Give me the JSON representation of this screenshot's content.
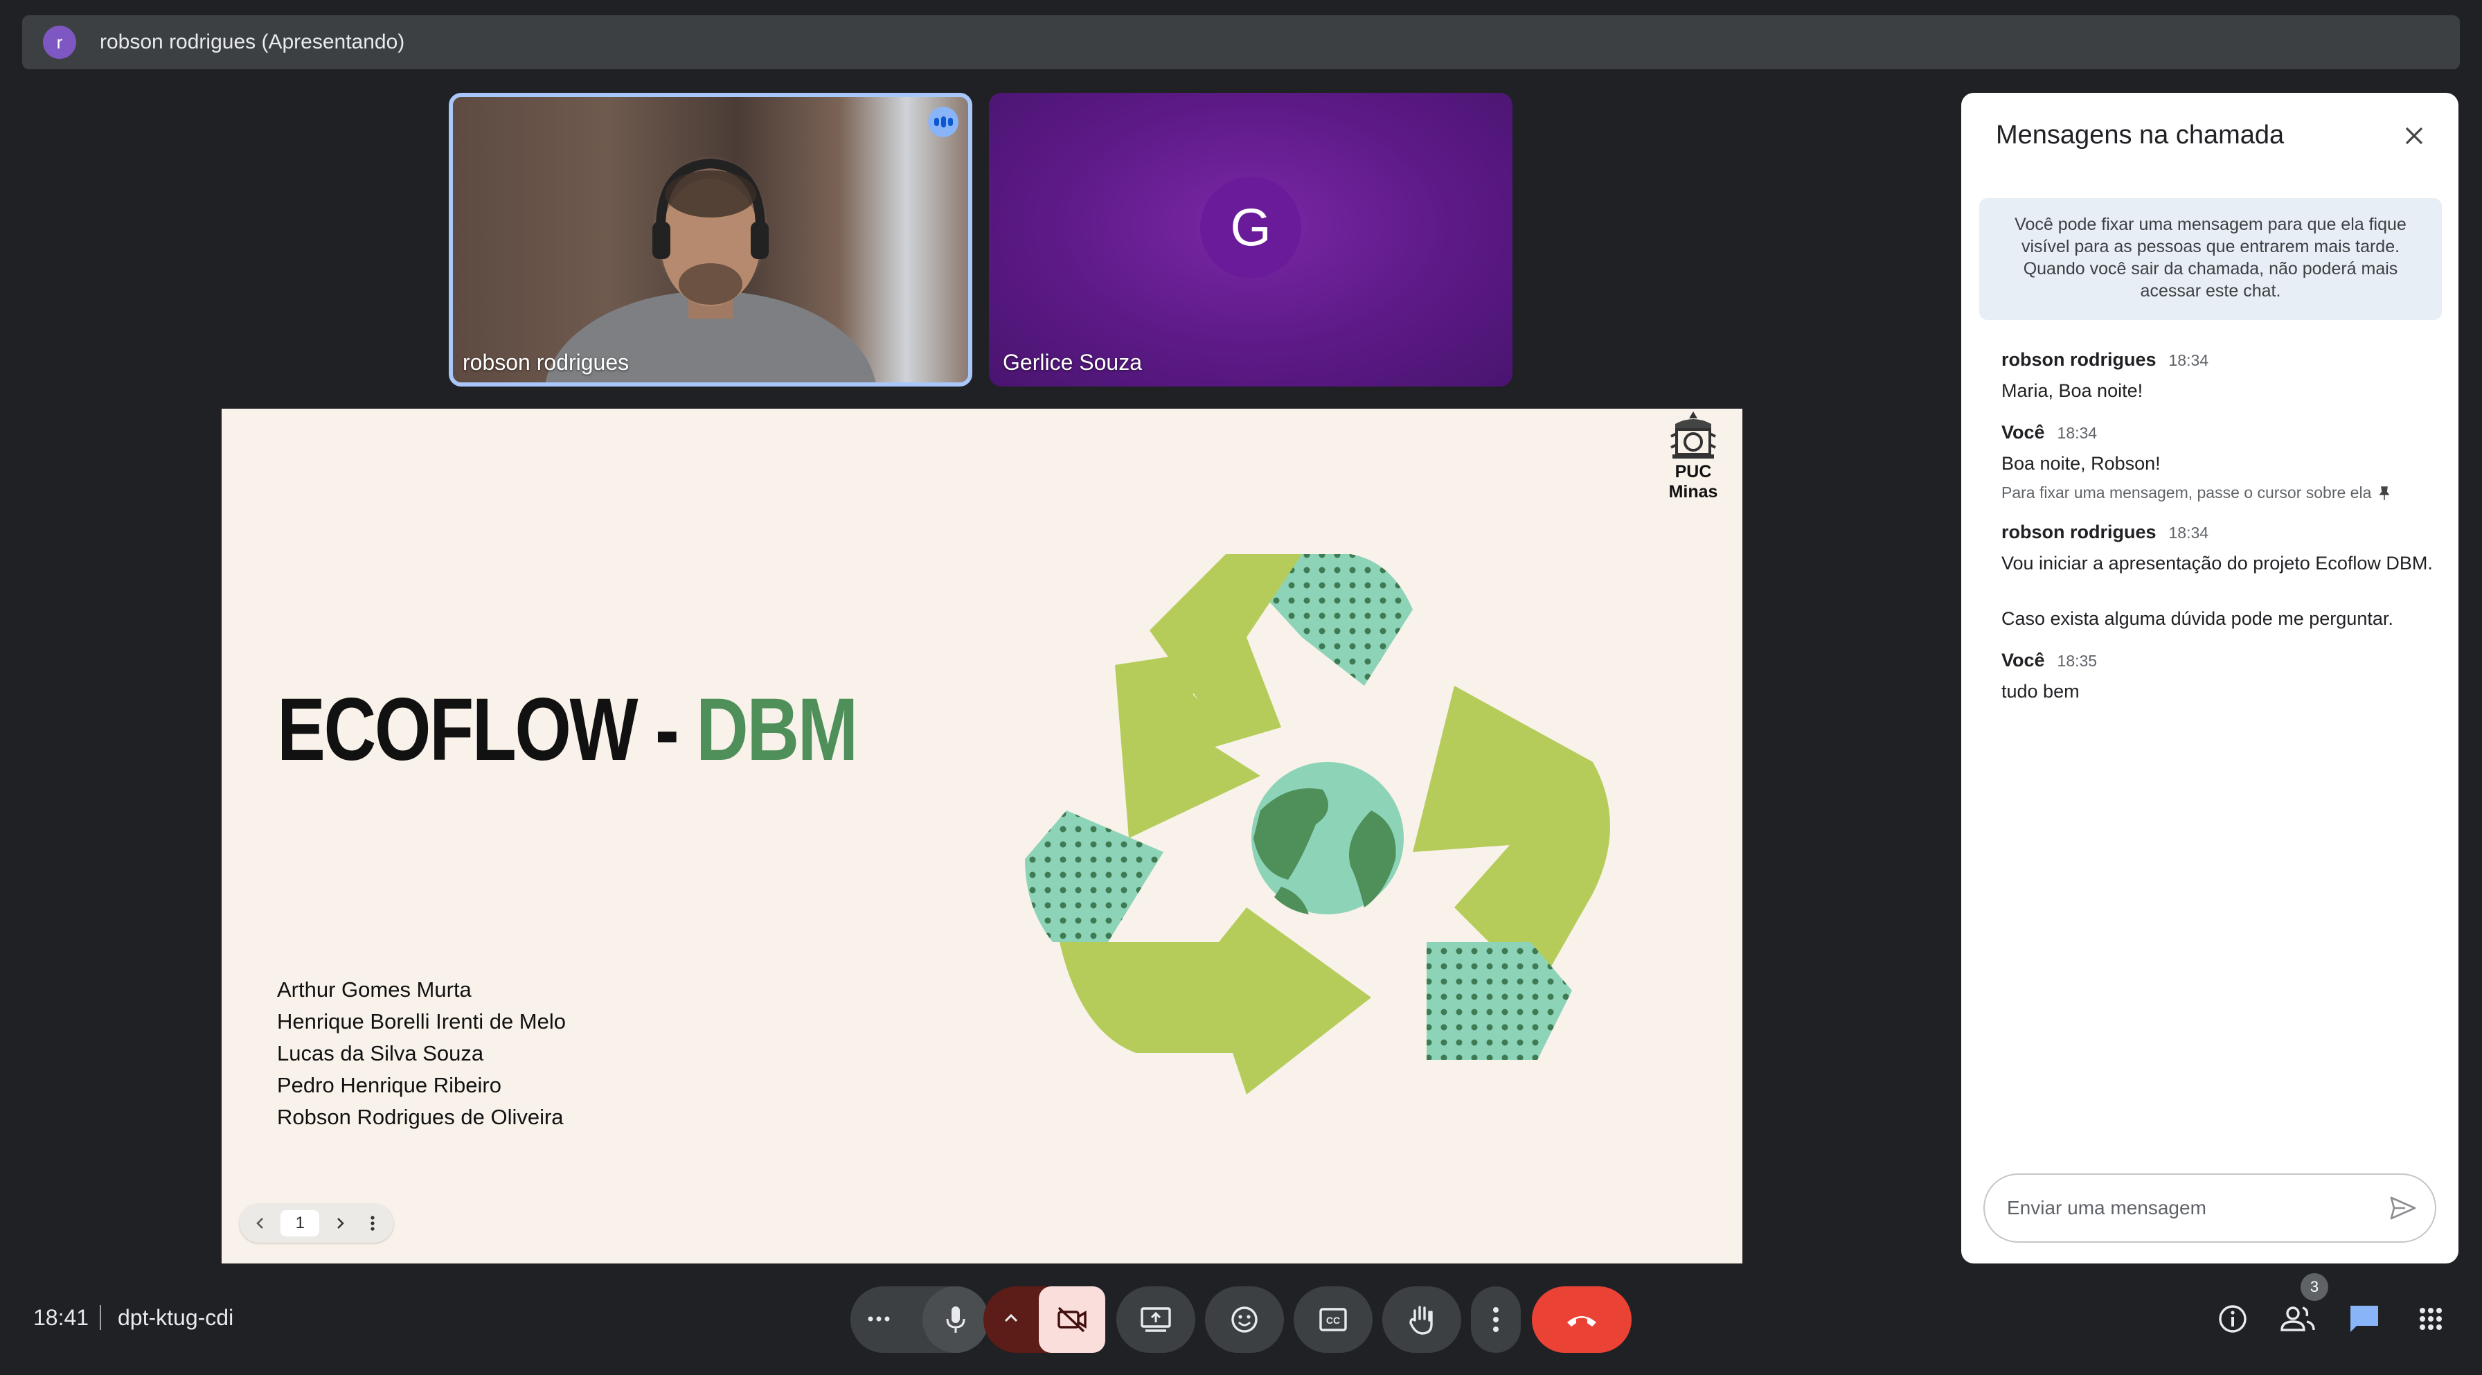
{
  "presenter_bar": {
    "avatar_letter": "r",
    "label": "robson rodrigues (Apresentando)"
  },
  "participants": [
    {
      "name": "robson rodrigues",
      "speaking": true
    },
    {
      "name": "Gerlice Souza",
      "avatar_letter": "G",
      "avatar_color": "#6a1b9a"
    }
  ],
  "slide": {
    "title_main": "ECOFLOW - ",
    "title_accent": "DBM",
    "brand": "PUC Minas",
    "authors": [
      "Arthur Gomes Murta",
      "Henrique Borelli Irenti de Melo",
      "Lucas da Silva Souza",
      "Pedro Henrique Ribeiro",
      "Robson Rodrigues de Oliveira"
    ],
    "page_number": "1",
    "colors": {
      "accent": "#4f8f5a",
      "arrow_green": "#b5cc5a",
      "mint": "#8dd3b8",
      "dark_green": "#4f8f5a"
    }
  },
  "chat": {
    "title": "Mensagens na chamada",
    "info": "Você pode fixar uma mensagem para que ela fique visível para as pessoas que entrarem mais tarde. Quando você sair da chamada, não poderá mais acessar este chat.",
    "messages": [
      {
        "sender": "robson rodrigues",
        "time": "18:34",
        "texts": [
          "Maria, Boa noite!"
        ]
      },
      {
        "sender": "Você",
        "time": "18:34",
        "texts": [
          "Boa noite, Robson!"
        ],
        "hint": "Para fixar uma mensagem, passe o cursor sobre ela"
      },
      {
        "sender": "robson rodrigues",
        "time": "18:34",
        "texts": [
          "Vou iniciar a apresentação do projeto Ecoflow DBM.",
          "Caso exista alguma dúvida pode me perguntar."
        ]
      },
      {
        "sender": "Você",
        "time": "18:35",
        "texts": [
          "tudo bem"
        ]
      }
    ],
    "input_placeholder": "Enviar uma mensagem"
  },
  "bottom_bar": {
    "time": "18:41",
    "meeting_code": "dpt-ktug-cdi",
    "people_count": "3",
    "leave_color": "#ea4335"
  },
  "icons": [
    "more-horiz-icon",
    "mic-icon",
    "chevron-up-icon",
    "videocam-off-icon",
    "present-screen-icon",
    "emoji-icon",
    "captions-icon",
    "raise-hand-icon",
    "more-vert-icon",
    "call-end-icon",
    "info-icon",
    "people-icon",
    "chat-icon",
    "apps-icon",
    "close-icon",
    "send-icon",
    "pin-icon"
  ]
}
